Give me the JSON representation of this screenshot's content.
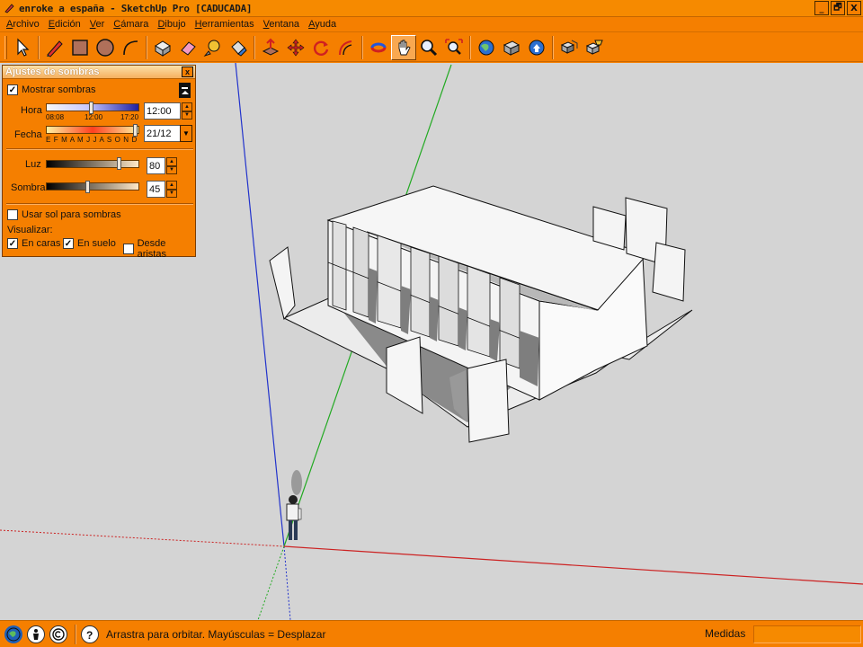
{
  "window": {
    "title": "enroke a españa - SketchUp Pro [CADUCADA]",
    "controls": [
      "_",
      "🗗",
      "X"
    ]
  },
  "menu": [
    "Archivo",
    "Edición",
    "Ver",
    "Cámara",
    "Dibujo",
    "Herramientas",
    "Ventana",
    "Ayuda"
  ],
  "toolbar": {
    "tools": [
      "select-icon",
      "pencil-icon",
      "rectangle-icon",
      "circle-icon",
      "arc-icon",
      "make-component-icon",
      "eraser-icon",
      "tape-measure-icon",
      "paint-bucket-icon",
      "push-pull-icon",
      "move-icon",
      "rotate-icon",
      "offset-icon",
      "orbit-icon",
      "pan-icon",
      "zoom-icon",
      "zoom-extents-icon",
      "get-models-icon",
      "share-model-icon",
      "upload-icon",
      "components-icon",
      "styles-icon"
    ]
  },
  "shadow_panel": {
    "title": "Ajustes de sombras",
    "close": "x",
    "show_shadows_label": "Mostrar sombras",
    "show_shadows": true,
    "time_label": "Hora",
    "time_ticks": [
      "08:08",
      "12:00",
      "17:20"
    ],
    "time_value": "12:00",
    "date_label": "Fecha",
    "date_months": "E F M A M J J A S O N D",
    "date_value": "21/12",
    "light_label": "Luz",
    "light_value": "80",
    "shadow_label": "Sombra",
    "shadow_value": "45",
    "use_sun_label": "Usar sol para sombras",
    "use_sun": false,
    "display_label": "Visualizar:",
    "on_faces_label": "En caras",
    "on_faces": true,
    "on_ground_label": "En suelo",
    "on_ground": true,
    "from_edges_label": "Desde aristas",
    "from_edges": false
  },
  "status": {
    "hint": "Arrastra para orbitar. Mayúsculas = Desplazar",
    "measures_label": "Medidas",
    "measures_value": ""
  },
  "colors": {
    "orange": "#f57f00",
    "canvas": "#d4d4d4",
    "axis_red": "#cc2222",
    "axis_green": "#22aa22",
    "axis_blue": "#2233cc"
  }
}
